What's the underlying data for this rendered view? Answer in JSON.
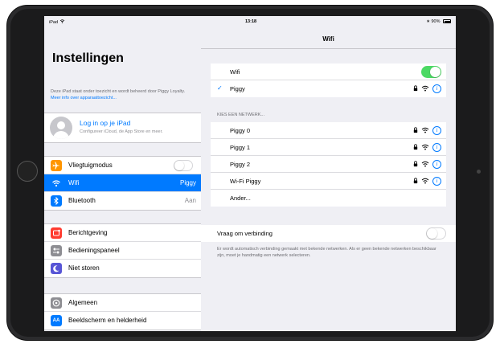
{
  "status_bar": {
    "device": "iPad",
    "time": "13:18",
    "battery": "90%"
  },
  "master": {
    "title": "Instellingen",
    "supervision_text": "Deze iPad staat onder toezicht en wordt beheerd door Piggy Loyalty.",
    "supervision_link": "Meer info over apparaattoezicht...",
    "account": {
      "title": "Log in op je iPad",
      "subtitle": "Configureer iCloud, de App Store en meer."
    },
    "group1": [
      {
        "label": "Vliegtuigmodus",
        "icon": "airplane-icon",
        "color": "#ff9500",
        "value": ""
      },
      {
        "label": "Wifi",
        "icon": "wifi-icon",
        "color": "#007aff",
        "value": "Piggy"
      },
      {
        "label": "Bluetooth",
        "icon": "bluetooth-icon",
        "color": "#007aff",
        "value": "Aan"
      }
    ],
    "group2": [
      {
        "label": "Berichtgeving",
        "icon": "notifications-icon",
        "color": "#ff3b30"
      },
      {
        "label": "Bedieningspaneel",
        "icon": "control-center-icon",
        "color": "#8e8e93"
      },
      {
        "label": "Niet storen",
        "icon": "moon-icon",
        "color": "#5856d6"
      }
    ],
    "group3": [
      {
        "label": "Algemeen",
        "icon": "gear-icon",
        "color": "#8e8e93"
      },
      {
        "label": "Beeldscherm en helderheid",
        "icon": "display-icon",
        "color": "#007aff",
        "glyph": "AA"
      }
    ]
  },
  "detail": {
    "title": "Wifi",
    "wifi_label": "Wifi",
    "wifi_on": true,
    "connected_network": "Piggy",
    "section_header": "KIES EEN NETWERK...",
    "networks": [
      "Piggy 0",
      "Piggy 1",
      "Piggy 2",
      "Wi-Fi Piggy"
    ],
    "other_label": "Ander...",
    "ask_join_label": "Vraag om verbinding",
    "ask_join_on": false,
    "ask_join_footer": "Er wordt automatisch verbinding gemaakt met bekende netwerken. Als er geen bekende netwerken beschikbaar zijn, moet je handmatig een netwerk selecteren."
  }
}
